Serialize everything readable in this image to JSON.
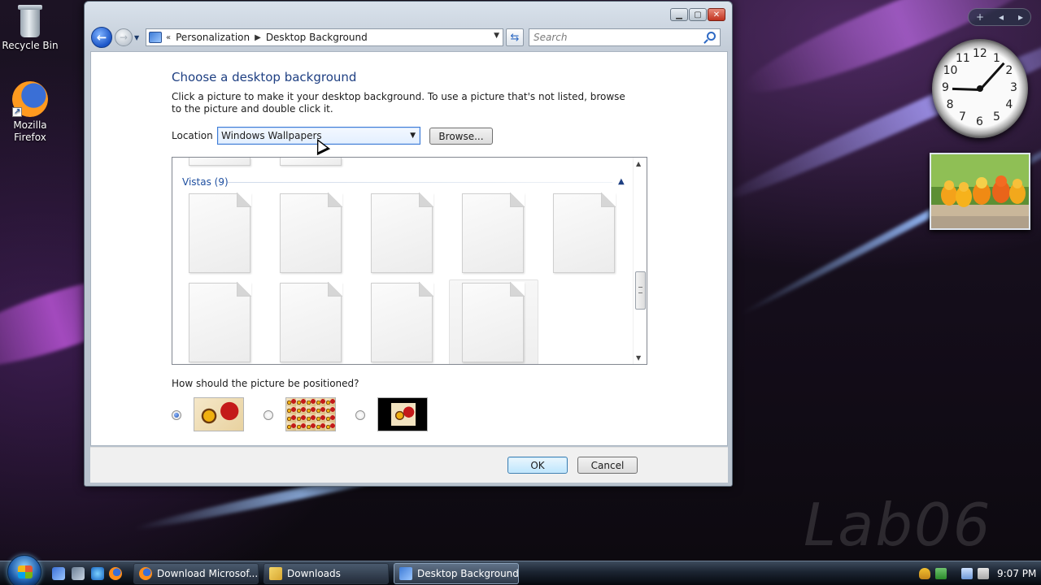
{
  "desktop": {
    "icons": [
      {
        "label": "Recycle Bin"
      },
      {
        "label": "Mozilla Firefox"
      }
    ],
    "watermark": "Lab06",
    "gadget_bar": {
      "add": "+",
      "prev": "◂",
      "next": "▸"
    },
    "clock_numbers": [
      "12",
      "1",
      "2",
      "3",
      "4",
      "5",
      "6",
      "7",
      "8",
      "9",
      "10",
      "11"
    ]
  },
  "window": {
    "caption": {
      "minimize": "▁",
      "maximize": "▢",
      "close": "✕"
    },
    "breadcrumb": [
      "Personalization",
      "Desktop Background"
    ],
    "search_placeholder": "Search",
    "page_title": "Choose a desktop background",
    "description": "Click a picture to make it your desktop background. To use a picture that's not listed, browse to the picture and double click it.",
    "location_label": "Location",
    "location_value": "Windows Wallpapers",
    "browse_label": "Browse...",
    "group": {
      "name": "Vistas (9)",
      "count": 9
    },
    "position_label": "How should the picture be positioned?",
    "position_options": [
      {
        "value": "fit",
        "selected": true
      },
      {
        "value": "tile",
        "selected": false
      },
      {
        "value": "center",
        "selected": false
      }
    ],
    "ok_label": "OK",
    "cancel_label": "Cancel"
  },
  "taskbar": {
    "tasks": [
      {
        "label": "Download Microsof...",
        "active": false
      },
      {
        "label": "Downloads",
        "active": false
      },
      {
        "label": "Desktop Background",
        "active": true
      }
    ],
    "clock": "9:07 PM"
  },
  "colors": {
    "title_blue": "#1e3f82",
    "group_blue": "#1e4fa0",
    "ok_border": "#3c7fb1"
  }
}
